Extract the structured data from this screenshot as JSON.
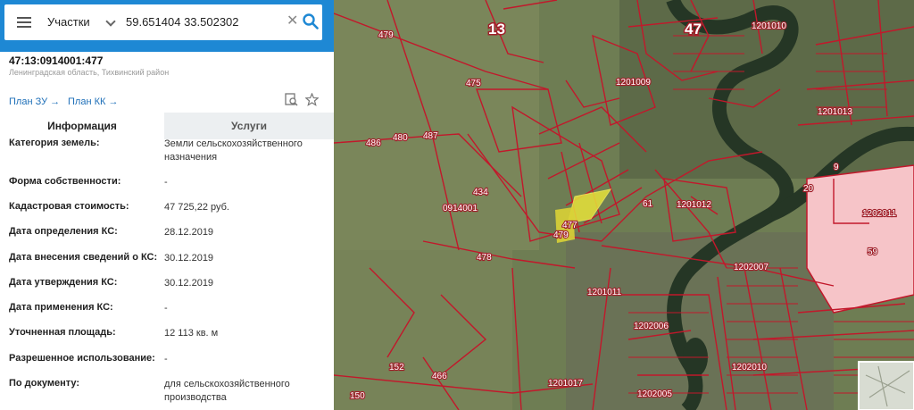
{
  "search": {
    "layer": "Участки",
    "query": "59.651404 33.502302",
    "clear_symbol": "✕",
    "collapse_symbol": "‹"
  },
  "parcel": {
    "cadastral_number": "47:13:0914001:477",
    "region": "Ленинградская область, Тихвинский район"
  },
  "links": {
    "plan_zu": "План ЗУ",
    "plan_kk": "План КК"
  },
  "tabs": {
    "info": "Информация",
    "services": "Услуги"
  },
  "attributes": [
    {
      "label": "Категория земель:",
      "value": "Земли сельскохозяйственного назначения"
    },
    {
      "label": "Форма собственности:",
      "value": "-"
    },
    {
      "label": "Кадастровая стоимость:",
      "value": "47 725,22 руб."
    },
    {
      "label": "Дата определения КС:",
      "value": "28.12.2019"
    },
    {
      "label": "Дата внесения сведений о КС:",
      "value": "30.12.2019"
    },
    {
      "label": "Дата утверждения КС:",
      "value": "30.12.2019"
    },
    {
      "label": "Дата применения КС:",
      "value": "-"
    },
    {
      "label": "Уточненная площадь:",
      "value": "12 113 кв. м"
    },
    {
      "label": "Разрешенное использование:",
      "value": "-"
    },
    {
      "label": "По документу:",
      "value": "для сельскохозяйственного производства"
    }
  ],
  "map": {
    "colors": {
      "boundary": "#c2182b",
      "selected": "#e8e33a",
      "highlight": "#f6c4c8",
      "water": "#233224"
    },
    "labels": [
      {
        "id": "label-47",
        "text": "47",
        "big": true
      },
      {
        "id": "label-13",
        "text": "13",
        "big": true
      },
      {
        "id": "label-479a",
        "text": "479"
      },
      {
        "id": "label-475",
        "text": "475"
      },
      {
        "id": "label-486",
        "text": "486"
      },
      {
        "id": "label-480",
        "text": "480"
      },
      {
        "id": "label-487",
        "text": "487"
      },
      {
        "id": "label-0914001",
        "text": "0914001"
      },
      {
        "id": "label-478",
        "text": "478"
      },
      {
        "id": "label-479b",
        "text": "479"
      },
      {
        "id": "label-477",
        "text": "477"
      },
      {
        "id": "label-1201009",
        "text": "1201009"
      },
      {
        "id": "label-1201010",
        "text": "1201010"
      },
      {
        "id": "label-1201013",
        "text": "1201013"
      },
      {
        "id": "label-1201012",
        "text": "1201012"
      },
      {
        "id": "label-1201011",
        "text": "1201011"
      },
      {
        "id": "label-1202011",
        "text": "1202011"
      },
      {
        "id": "label-59",
        "text": "59"
      },
      {
        "id": "label-1202007",
        "text": "1202007"
      },
      {
        "id": "label-1202006",
        "text": "1202006"
      },
      {
        "id": "label-1202010",
        "text": "1202010"
      },
      {
        "id": "label-1201017",
        "text": "1201017"
      },
      {
        "id": "label-1202005",
        "text": "1202005"
      },
      {
        "id": "label-152",
        "text": "152"
      },
      {
        "id": "label-466",
        "text": "466"
      },
      {
        "id": "label-150",
        "text": "150"
      },
      {
        "id": "label-61",
        "text": "61"
      },
      {
        "id": "label-9",
        "text": "9"
      },
      {
        "id": "label-20",
        "text": "20"
      },
      {
        "id": "label-434",
        "text": "434"
      }
    ]
  }
}
